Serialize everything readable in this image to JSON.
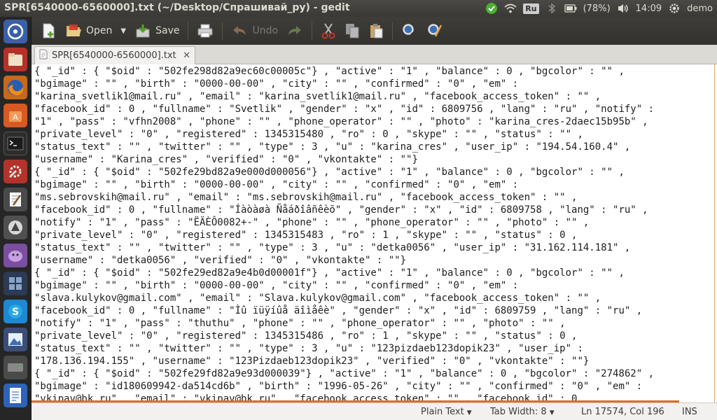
{
  "window_title": "SPR[6540000-6560000].txt (~/Desktop/Спрашивай_ру) - gedit",
  "tray": {
    "keyboard_layout": "Ru",
    "battery": "(78%)",
    "time": "14:09",
    "user": "demo"
  },
  "toolbar": {
    "new_icon": "new-document-icon",
    "open_label": "Open",
    "save_label": "Save",
    "undo_label": "Undo"
  },
  "tab": {
    "label": "SPR[6540000-6560000].txt",
    "close": "✕"
  },
  "editor_lines": [
    "{ \"_id\" : { \"$oid\" : \"502fe298d82a9ec60c00005c\"} , \"active\" : \"1\" , \"balance\" : 0 , \"bgcolor\" : \"\" ,",
    "\"bgimage\" : \"\" , \"birth\" : \"0000-00-00\" , \"city\" : \"\" , \"confirmed\" : \"0\" , \"em\" :",
    "\"karina_svetlik1@mail.ru\" , \"email\" : \"karina_svetlik1@mail.ru\" , \"facebook_access_token\" : \"\" ,",
    "\"facebook_id\" : 0 , \"fullname\" : \"Svetlik\" , \"gender\" : \"x\" , \"id\" : 6809756 , \"lang\" : \"ru\" , \"notify\" :",
    "\"1\" , \"pass\" : \"vfhn2008\" , \"phone\" : \"\" , \"phone_operator\" : \"\" , \"photo\" : \"karina_cres-2daec15b95b\" ,",
    "\"private_level\" : \"0\" , \"registered\" : 1345315480 , \"ro\" : 0 , \"skype\" : \"\" , \"status\" : \"\" ,",
    "\"status_text\" : \"\" , \"twitter\" : \"\" , \"type\" : 3 , \"u\" : \"karina_cres\" , \"user_ip\" : \"194.54.160.4\" ,",
    "\"username\" : \"Karina_cres\" , \"verified\" : \"0\" , \"vkontakte\" : \"\"}",
    "{ \"_id\" : { \"$oid\" : \"502fe29bd82a9e000d000056\"} , \"active\" : \"1\" , \"balance\" : 0 , \"bgcolor\" : \"\" ,",
    "\"bgimage\" : \"\" , \"birth\" : \"0000-00-00\" , \"city\" : \"\" , \"confirmed\" : \"0\" , \"em\" :",
    "\"ms.sebrovskih@mail.ru\" , \"email\" : \"ms.sebrovskih@mail.ru\" , \"facebook_access_token\" : \"\" ,",
    "\"facebook_id\" : 0 , \"fullname\" : \"Íàòàøà Ñåáðîâñêèõ\" , \"gender\" : \"x\" , \"id\" : 6809758 , \"lang\" : \"ru\" ,",
    "\"notify\" : \"1\" , \"pass\" : \"ËÄÈÔ0082+-\" , \"phone\" : \"\" , \"phone_operator\" : \"\" , \"photo\" : \"\" ,",
    "\"private_level\" : \"0\" , \"registered\" : 1345315483 , \"ro\" : 1 , \"skype\" : \"\" , \"status\" : 0 ,",
    "\"status_text\" : \"\" , \"twitter\" : \"\" , \"type\" : 3 , \"u\" : \"detka0056\" , \"user_ip\" : \"31.162.114.181\" ,",
    "\"username\" : \"detka0056\" , \"verified\" : \"0\" , \"vkontakte\" : \"\"}",
    "{ \"_id\" : { \"$oid\" : \"502fe29ed82a9e4b0d00001f\"} , \"active\" : \"1\" , \"balance\" : 0 , \"bgcolor\" : \"\" ,",
    "\"bgimage\" : \"\" , \"birth\" : \"0000-00-00\" , \"city\" : \"\" , \"confirmed\" : \"0\" , \"em\" :",
    "\"slava.kulykov@gmail.com\" , \"email\" : \"Slava.kulykov@gmail.com\" , \"facebook_access_token\" : \"\" ,",
    "\"facebook_id\" : 0 , \"fullname\" : \"Ìû ïüÿíûå äîìåêè\" , \"gender\" : \"x\" , \"id\" : 6809759 , \"lang\" : \"ru\" ,",
    "\"notify\" : \"1\" , \"pass\" : \"thuthu\" , \"phone\" : \"\" , \"phone_operator\" : \"\" , \"photo\" : \"\" ,",
    "\"private_level\" : \"0\" , \"registered\" : 1345315486 , \"ro\" : 1 , \"skype\" : \"\" , \"status\" : 0 ,",
    "\"status_text\" : \"\" , \"twitter\" : \"\" , \"type\" : 3 , \"u\" : \"123pizdaeb123dopik23\" , \"user_ip\" :",
    "\"178.136.194.155\" , \"username\" : \"123Pizdaeb123dopik23\" , \"verified\" : \"0\" , \"vkontakte\" : \"\"}",
    "{ \"_id\" : { \"$oid\" : \"502fe29fd82a9e93d000039\"} , \"active\" : \"1\" , \"balance\" : 0 , \"bgcolor\" : \"274862\" ,",
    "\"bgimage\" : \"id180609942-da514cd6b\" , \"birth\" : \"1996-05-26\" , \"city\" : \"\" , \"confirmed\" : \"0\" , \"em\" :",
    "\"vkipav@bk.ru\" , \"email\" : \"vkipav@bk.ru\" , \"facebook_access_token\" : \"\" , \"facebook_id\" : 0 ,"
  ],
  "status": {
    "language": "Plain Text",
    "tab_width": "Tab Width: 8",
    "position": "Ln 17574, Col 196",
    "mode": "INS"
  }
}
